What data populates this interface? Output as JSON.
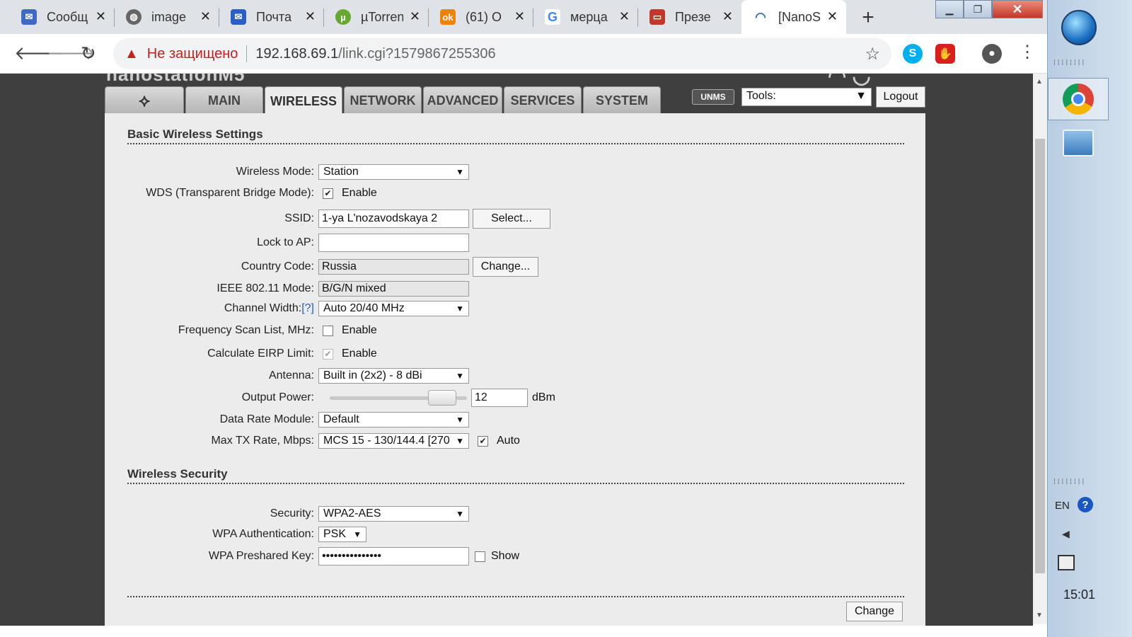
{
  "browser": {
    "tabs": [
      {
        "title": "Сообщ",
        "icon": "message-icon",
        "color": "#3d6ac6"
      },
      {
        "title": "image",
        "icon": "globe-icon",
        "color": "#666666"
      },
      {
        "title": "Почта",
        "icon": "mail-icon",
        "color": "#2b5fc7"
      },
      {
        "title": "µTorrent",
        "icon": "utorrent-icon",
        "color": "#64a830"
      },
      {
        "title": "(61) О",
        "icon": "odnoklassniki-icon",
        "color": "#ee8208"
      },
      {
        "title": "мерца",
        "icon": "google-icon",
        "color": "#4285f4"
      },
      {
        "title": "Презе",
        "icon": "presentation-icon",
        "color": "#c0392b"
      },
      {
        "title": "[NanoS",
        "icon": "rss-icon",
        "color": "#2f6bbd"
      }
    ],
    "security_label": "Не защищено",
    "url_host": "192.168.69.1",
    "url_path": "/link.cgi?1579867255306"
  },
  "device": {
    "nav_tabs": [
      "MAIN",
      "WIRELESS",
      "NETWORK",
      "ADVANCED",
      "SERVICES",
      "SYSTEM"
    ],
    "active_tab": "WIRELESS",
    "unms_label": "UNMS",
    "tools_label": "Tools:",
    "logout_label": "Logout"
  },
  "basic": {
    "title": "Basic Wireless Settings",
    "wireless_mode_label": "Wireless Mode:",
    "wireless_mode_value": "Station",
    "wds_label": "WDS (Transparent Bridge Mode):",
    "wds_checked": true,
    "enable_label": "Enable",
    "ssid_label": "SSID:",
    "ssid_value": "1-ya L'nozavodskaya 2",
    "select_button": "Select...",
    "lock_label": "Lock to AP:",
    "lock_value": "",
    "country_label": "Country Code:",
    "country_value": "Russia",
    "change_button": "Change...",
    "ieee_label": "IEEE 802.11 Mode:",
    "ieee_value": "B/G/N mixed",
    "channel_label": "Channel Width:",
    "channel_help": "[?]",
    "channel_value": "Auto 20/40 MHz",
    "freq_label": "Frequency Scan List, MHz:",
    "freq_checked": false,
    "eirp_label": "Calculate EIRP Limit:",
    "eirp_checked": true,
    "antenna_label": "Antenna:",
    "antenna_value": "Built in (2x2) - 8 dBi",
    "power_label": "Output Power:",
    "power_value": "12",
    "power_unit": "dBm",
    "power_fraction": 0.9,
    "rate_module_label": "Data Rate Module:",
    "rate_module_value": "Default",
    "max_tx_label": "Max TX Rate, Mbps:",
    "max_tx_value": "MCS 15 - 130/144.4 [270",
    "auto_label": "Auto",
    "auto_checked": true
  },
  "security": {
    "title": "Wireless Security",
    "security_label": "Security:",
    "security_value": "WPA2-AES",
    "auth_label": "WPA Authentication:",
    "auth_value": "PSK",
    "key_label": "WPA Preshared Key:",
    "key_value": "•••••••••••••••",
    "show_label": "Show",
    "show_checked": false,
    "change_label": "Change"
  },
  "taskbar": {
    "lang": "EN",
    "help": "?",
    "clock": "15:01"
  }
}
